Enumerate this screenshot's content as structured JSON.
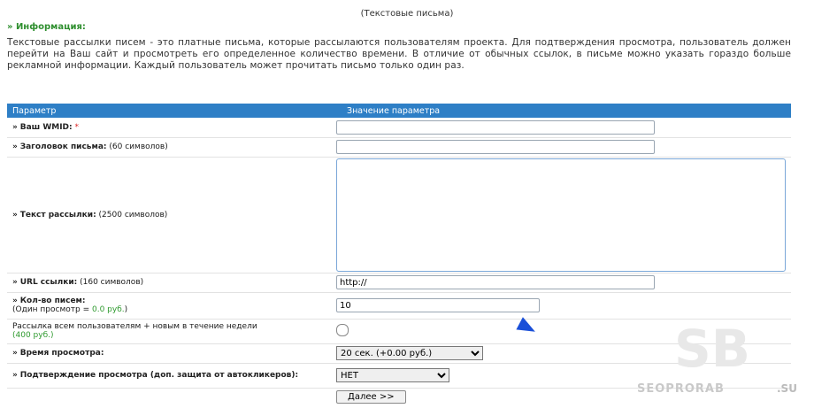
{
  "page": {
    "title": "(Текстовые письма)",
    "info_heading": "» Информация:",
    "intro": "Текстовые рассылки писем - это платные письма, которые рассылаются пользователям проекта. Для подтверждения просмотра, пользователь должен перейти на Ваш сайт и просмотреть его определенное количество времени. В отличие от обычных ссылок, в письме можно указать гораздо больше рекламной информации. Каждый пользователь может прочитать письмо только один раз."
  },
  "table": {
    "col_param": "Параметр",
    "col_value": "Значение параметра"
  },
  "rows": {
    "wmid": {
      "arrow": "»",
      "label": "Ваш WMID:",
      "required": "*",
      "value": ""
    },
    "subject": {
      "arrow": "»",
      "label": "Заголовок письма:",
      "hint": "(60 символов)",
      "value": ""
    },
    "text": {
      "arrow": "»",
      "label": "Текст рассылки:",
      "hint": "(2500 символов)",
      "value": ""
    },
    "url": {
      "arrow": "»",
      "label": "URL ссылки:",
      "hint": "(160 символов)",
      "value": "http://"
    },
    "count": {
      "arrow": "»",
      "label": "Кол-во писем:",
      "hint_prefix": "(Один просмотр = ",
      "price": "0.0 руб.",
      "hint_suffix": ")",
      "value": "10"
    },
    "broadcast": {
      "label": "Рассылка всем пользователям + новым в течение недели",
      "price": "(400 руб.)"
    },
    "view_time": {
      "arrow": "»",
      "label": "Время просмотра:",
      "selected": "20 сек. (+0.00 руб.)"
    },
    "confirm": {
      "arrow": "»",
      "label": "Подтверждение просмотра (доп. защита от автокликеров):",
      "selected": "НЕТ"
    },
    "submit": {
      "label": "Далее >>"
    }
  },
  "watermark": {
    "text": "SEOPRORAB",
    "suffix": ".SU",
    "logo": "SB"
  },
  "colors": {
    "header_bg": "#2e7fc6",
    "heading_green": "#2f8f2f",
    "required_red": "#d22222"
  }
}
